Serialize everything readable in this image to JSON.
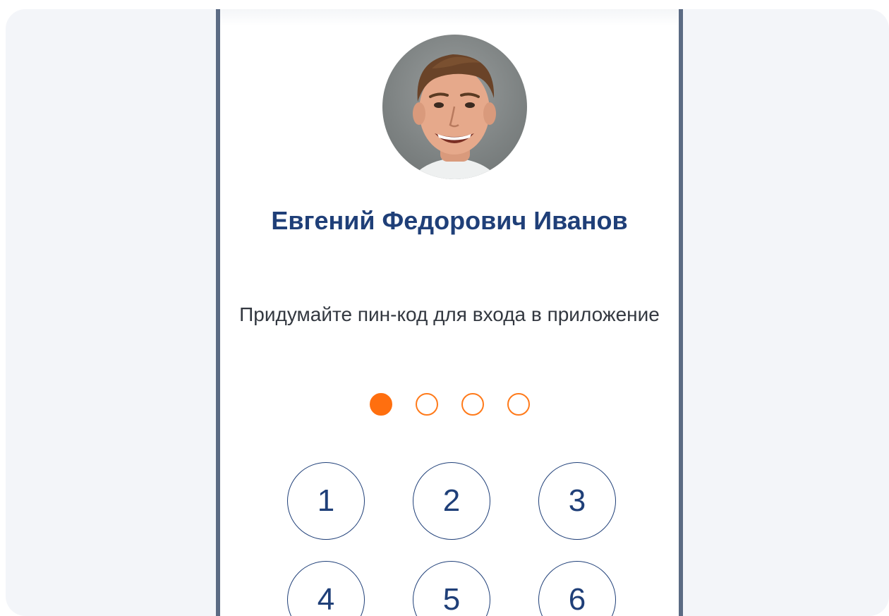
{
  "profile": {
    "name": "Евгений Федорович Иванов",
    "avatar_icon": "user-photo"
  },
  "pin": {
    "prompt": "Придумайте пин-код для входа в приложение",
    "length": 4,
    "entered": 1,
    "accent_color": "#ff6f0f"
  },
  "keypad": {
    "keys": [
      "1",
      "2",
      "3",
      "4",
      "5",
      "6"
    ]
  },
  "colors": {
    "primary": "#1f3f78",
    "accent": "#ff6f0f",
    "frame": "#5b6b84"
  }
}
